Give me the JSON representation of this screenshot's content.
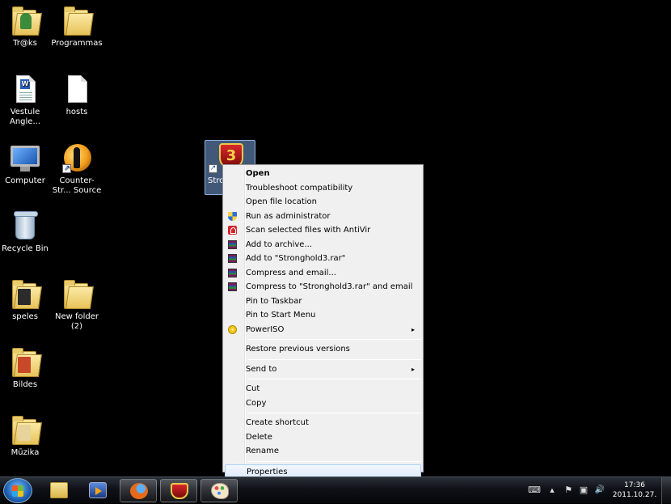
{
  "desktop": {
    "icons": [
      {
        "label": "Tr@ks"
      },
      {
        "label": "Programmas"
      },
      {
        "label": "Vestule Angle..."
      },
      {
        "label": "hosts"
      },
      {
        "label": "Computer"
      },
      {
        "label": "Counter-Str... Source"
      },
      {
        "label": "Recycle Bin"
      },
      {
        "label": "speles"
      },
      {
        "label": "New folder (2)"
      },
      {
        "label": "Bildes"
      },
      {
        "label": "Mūzika"
      }
    ],
    "selected_icon": {
      "label": "Stron",
      "glyph": "3"
    }
  },
  "context_menu": {
    "items": [
      {
        "label": "Open",
        "bold": true
      },
      {
        "label": "Troubleshoot compatibility"
      },
      {
        "label": "Open file location"
      },
      {
        "label": "Run as administrator",
        "icon": "uac-shield-icon"
      },
      {
        "label": "Scan selected files with AntiVir",
        "icon": "antivir-icon"
      },
      {
        "label": "Add to archive...",
        "icon": "winrar-icon"
      },
      {
        "label": "Add to \"Stronghold3.rar\"",
        "icon": "winrar-icon"
      },
      {
        "label": "Compress and email...",
        "icon": "winrar-icon"
      },
      {
        "label": "Compress to \"Stronghold3.rar\" and email",
        "icon": "winrar-icon"
      },
      {
        "label": "Pin to Taskbar"
      },
      {
        "label": "Pin to Start Menu"
      },
      {
        "label": "PowerISO",
        "icon": "poweriso-icon",
        "submenu": true
      },
      {
        "label": "Restore previous versions"
      },
      {
        "label": "Send to",
        "submenu": true
      },
      {
        "label": "Cut"
      },
      {
        "label": "Copy"
      },
      {
        "label": "Create shortcut"
      },
      {
        "label": "Delete"
      },
      {
        "label": "Rename"
      },
      {
        "label": "Properties",
        "highlighted": true
      }
    ],
    "submenu_arrow": "▸"
  },
  "taskbar": {
    "pinned": [
      "windows-explorer-icon",
      "media-player-icon",
      "firefox-icon",
      "stronghold-icon",
      "paint-icon"
    ],
    "tray_icons": [
      "keyboard-icon",
      "show-hidden-icons-icon",
      "action-center-icon",
      "network-icon",
      "volume-icon"
    ],
    "tray_glyphs": {
      "up": "▲",
      "volume": "🔊"
    },
    "clock": {
      "time": "17:36",
      "date": "2011.10.27."
    }
  },
  "colors": {
    "desktop": "#000000",
    "menu_bg": "#f0f0f0",
    "selection": "#aecff7"
  }
}
